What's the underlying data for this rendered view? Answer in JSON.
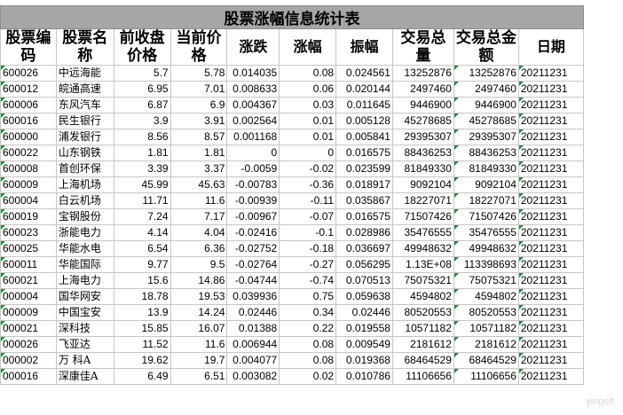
{
  "title": "股票涨幅信息统计表",
  "headers": [
    "股票编码",
    "股票名称",
    "前收盘价格",
    "当前价格",
    "涨跌",
    "涨幅",
    "振幅",
    "交易总量",
    "交易总金额",
    "日期"
  ],
  "rows": [
    [
      "600026",
      "中远海能",
      "5.7",
      "5.78",
      "0.014035",
      "0.08",
      "0.024561",
      "13252876",
      "13252876",
      "20211231"
    ],
    [
      "600012",
      "皖通高速",
      "6.95",
      "7.01",
      "0.008633",
      "0.06",
      "0.020144",
      "2497460",
      "2497460",
      "20211231"
    ],
    [
      "600006",
      "东风汽车",
      "6.87",
      "6.9",
      "0.004367",
      "0.03",
      "0.011645",
      "9446900",
      "9446900",
      "20211231"
    ],
    [
      "600016",
      "民生银行",
      "3.9",
      "3.91",
      "0.002564",
      "0.01",
      "0.005128",
      "45278685",
      "45278685",
      "20211231"
    ],
    [
      "600000",
      "浦发银行",
      "8.56",
      "8.57",
      "0.001168",
      "0.01",
      "0.005841",
      "29395307",
      "29395307",
      "20211231"
    ],
    [
      "600022",
      "山东钢铁",
      "1.81",
      "1.81",
      "0",
      "0",
      "0.016575",
      "88436253",
      "88436253",
      "20211231"
    ],
    [
      "600008",
      "首创环保",
      "3.39",
      "3.37",
      "-0.0059",
      "-0.02",
      "0.023599",
      "81849330",
      "81849330",
      "20211231"
    ],
    [
      "600009",
      "上海机场",
      "45.99",
      "45.63",
      "-0.00783",
      "-0.36",
      "0.018917",
      "9092104",
      "9092104",
      "20211231"
    ],
    [
      "600004",
      "白云机场",
      "11.71",
      "11.6",
      "-0.00939",
      "-0.11",
      "0.035867",
      "18227071",
      "18227071",
      "20211231"
    ],
    [
      "600019",
      "宝钢股份",
      "7.24",
      "7.17",
      "-0.00967",
      "-0.07",
      "0.016575",
      "71507426",
      "71507426",
      "20211231"
    ],
    [
      "600023",
      "浙能电力",
      "4.14",
      "4.04",
      "-0.02416",
      "-0.1",
      "0.028986",
      "35476555",
      "35476555",
      "20211231"
    ],
    [
      "600025",
      "华能水电",
      "6.54",
      "6.36",
      "-0.02752",
      "-0.18",
      "0.036697",
      "49948632",
      "49948632",
      "20211231"
    ],
    [
      "600011",
      "华能国际",
      "9.77",
      "9.5",
      "-0.02764",
      "-0.27",
      "0.056295",
      "1.13E+08",
      "113398693",
      "20211231"
    ],
    [
      "600021",
      "上海电力",
      "15.6",
      "14.86",
      "-0.04744",
      "-0.74",
      "0.070513",
      "75075321",
      "75075321",
      "20211231"
    ],
    [
      "000004",
      "国华网安",
      "18.78",
      "19.53",
      "0.039936",
      "0.75",
      "0.059638",
      "4594802",
      "4594802",
      "20211231"
    ],
    [
      "000009",
      "中国宝安",
      "13.9",
      "14.24",
      "0.02446",
      "0.34",
      "0.02446",
      "80520553",
      "80520553",
      "20211231"
    ],
    [
      "000021",
      "深科技",
      "15.85",
      "16.07",
      "0.01388",
      "0.22",
      "0.019558",
      "10571182",
      "10571182",
      "20211231"
    ],
    [
      "000026",
      "飞亚达",
      "11.52",
      "11.6",
      "0.006944",
      "0.08",
      "0.009549",
      "2181612",
      "2181612",
      "20211231"
    ],
    [
      "000002",
      "万 科A",
      "19.62",
      "19.7",
      "0.004077",
      "0.08",
      "0.019368",
      "68464529",
      "68464529",
      "20211231"
    ],
    [
      "000016",
      "深康佳A",
      "6.49",
      "6.51",
      "0.003082",
      "0.02",
      "0.010786",
      "11106656",
      "11106656",
      "20211231"
    ]
  ],
  "watermark": "yingeit"
}
